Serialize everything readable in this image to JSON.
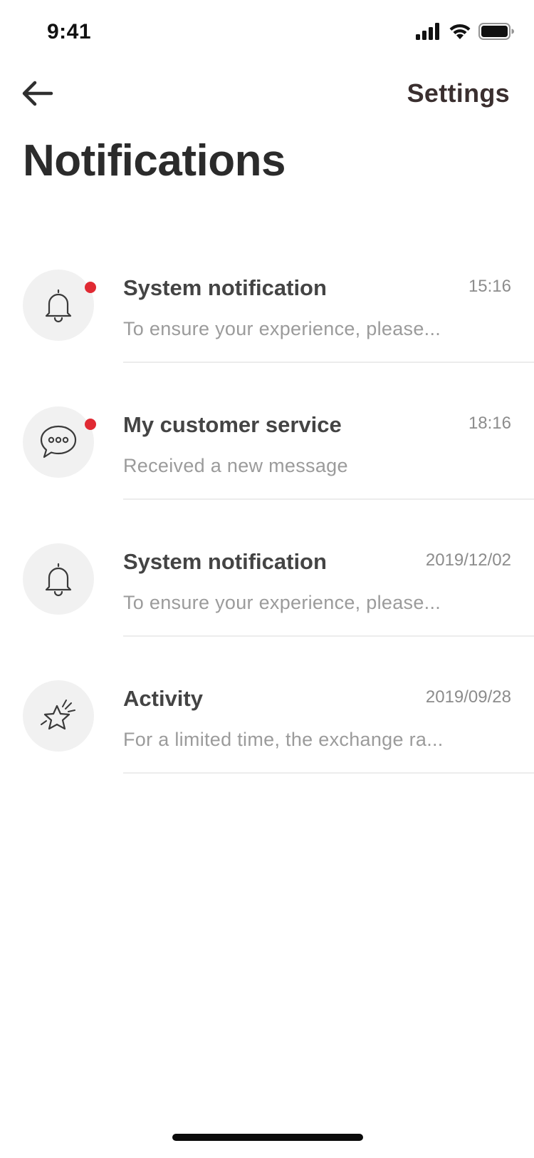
{
  "status_bar": {
    "time": "9:41",
    "icons": [
      "signal-icon",
      "wifi-icon",
      "battery-icon"
    ]
  },
  "header": {
    "back_icon": "arrow-left-icon",
    "settings_label": "Settings",
    "title": "Notifications"
  },
  "notifications": [
    {
      "icon": "bell-icon",
      "unread": true,
      "title": "System notification",
      "time": "15:16",
      "preview": "To ensure your experience, please..."
    },
    {
      "icon": "chat-bubble-icon",
      "unread": true,
      "title": "My customer service",
      "time": "18:16",
      "preview": "Received a new message"
    },
    {
      "icon": "bell-icon",
      "unread": false,
      "title": "System notification",
      "time": "2019/12/02",
      "preview": "To ensure your experience, please..."
    },
    {
      "icon": "star-icon",
      "unread": false,
      "title": "Activity",
      "time": "2019/09/28",
      "preview": "For a limited time, the exchange ra..."
    }
  ],
  "colors": {
    "unread_dot": "#e02a33",
    "avatar_bg": "#f1f1f1",
    "title_text": "#2b2b2b",
    "secondary_text": "#9b9b9b"
  }
}
